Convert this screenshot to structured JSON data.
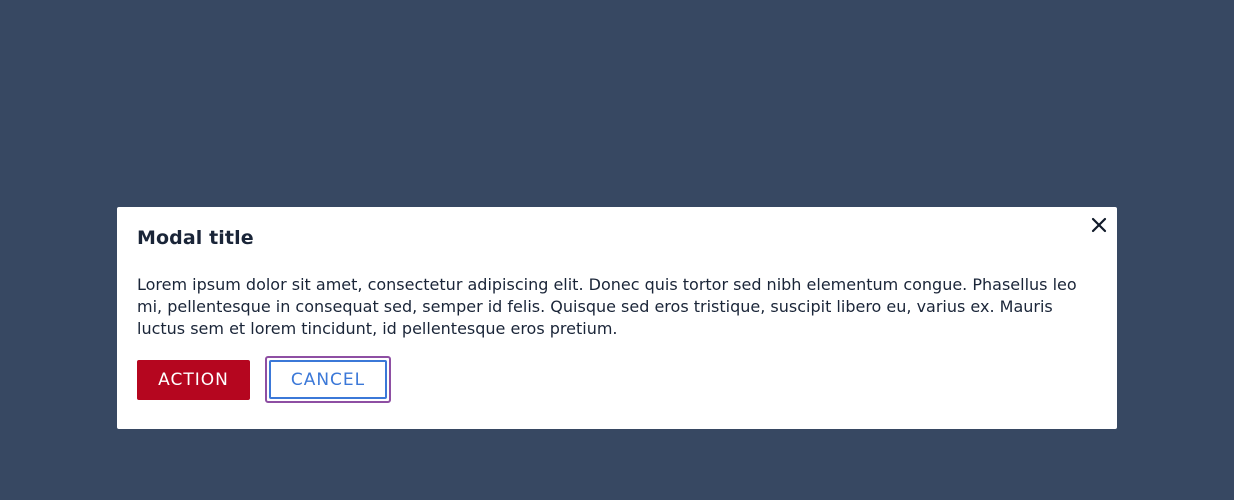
{
  "modal": {
    "title": "Modal title",
    "body": "Lorem ipsum dolor sit amet, consectetur adipiscing elit. Donec quis tortor sed nibh elementum congue. Phasellus leo mi, pellentesque in consequat sed, semper id felis. Quisque sed eros tristique, suscipit libero eu, varius ex. Mauris luctus sem et lorem tincidunt, id pellentesque eros pretium.",
    "close_icon": "close-icon",
    "buttons": {
      "action_label": "ACTION",
      "cancel_label": "CANCEL"
    }
  },
  "colors": {
    "backdrop": "#374862",
    "modal_bg": "#ffffff",
    "action_bg": "#b5061f",
    "cancel_border": "#3b78d8",
    "focus_ring": "#8e4fa3",
    "text": "#1a2538"
  }
}
